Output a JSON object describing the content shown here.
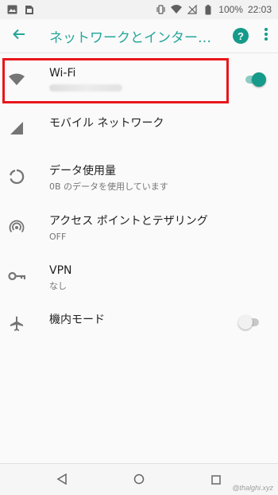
{
  "status_bar": {
    "battery": "100%",
    "time": "22:03"
  },
  "app_bar": {
    "title": "ネットワークとインター…",
    "accent_color": "#26a69a"
  },
  "items": [
    {
      "title": "Wi-Fi",
      "subtitle": "",
      "icon": "wifi-icon",
      "toggle": "on"
    },
    {
      "title": "モバイル ネットワーク",
      "subtitle": "",
      "icon": "cellular-signal-icon"
    },
    {
      "title": "データ使用量",
      "subtitle": "0B のデータを使用しています",
      "icon": "data-usage-icon"
    },
    {
      "title": "アクセス ポイントとテザリング",
      "subtitle": "OFF",
      "icon": "hotspot-icon"
    },
    {
      "title": "VPN",
      "subtitle": "なし",
      "icon": "key-icon"
    },
    {
      "title": "機内モード",
      "subtitle": "",
      "icon": "airplane-icon",
      "toggle": "off"
    }
  ],
  "watermark": "@thalghi.xyz"
}
